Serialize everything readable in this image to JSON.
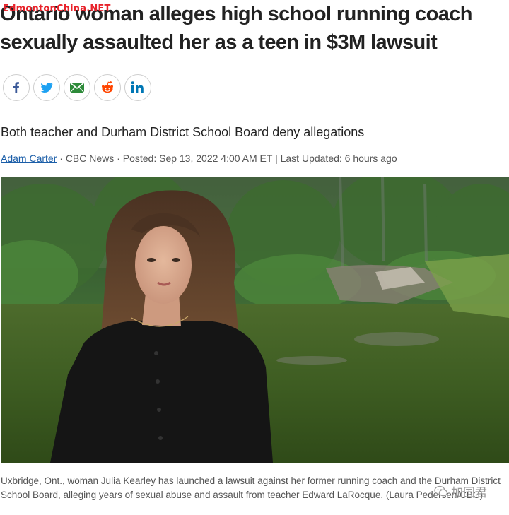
{
  "watermark": "EdmontonChina.NET",
  "article": {
    "headline": "Ontario woman alleges high school running coach sexually assaulted her as a teen in $3M lawsuit",
    "subhead": "Both teacher and Durham District School Board deny allegations",
    "byline": {
      "author": "Adam Carter",
      "sep1": " · ",
      "source": "CBC News",
      "sep2": " · ",
      "posted": "Posted: Sep 13, 2022 4:00 AM ET",
      "sep3": " | ",
      "updated": "Last Updated: 6 hours ago"
    },
    "caption": "Uxbridge, Ont., woman Julia Kearley has launched a lawsuit against her former running coach and the Durham District School Board, alleging years of sexual abuse and assault from teacher Edward LaRocque. (Laura Pedersen/CBC)"
  },
  "share": [
    {
      "name": "facebook",
      "icon": "facebook-icon",
      "color": "#3b5998"
    },
    {
      "name": "twitter",
      "icon": "twitter-icon",
      "color": "#1da1f2"
    },
    {
      "name": "email",
      "icon": "email-icon",
      "color": "#2e8b3a"
    },
    {
      "name": "reddit",
      "icon": "reddit-icon",
      "color": "#ff4500"
    },
    {
      "name": "linkedin",
      "icon": "linkedin-icon",
      "color": "#0077b5"
    }
  ],
  "wechat_watermark": "加国君"
}
